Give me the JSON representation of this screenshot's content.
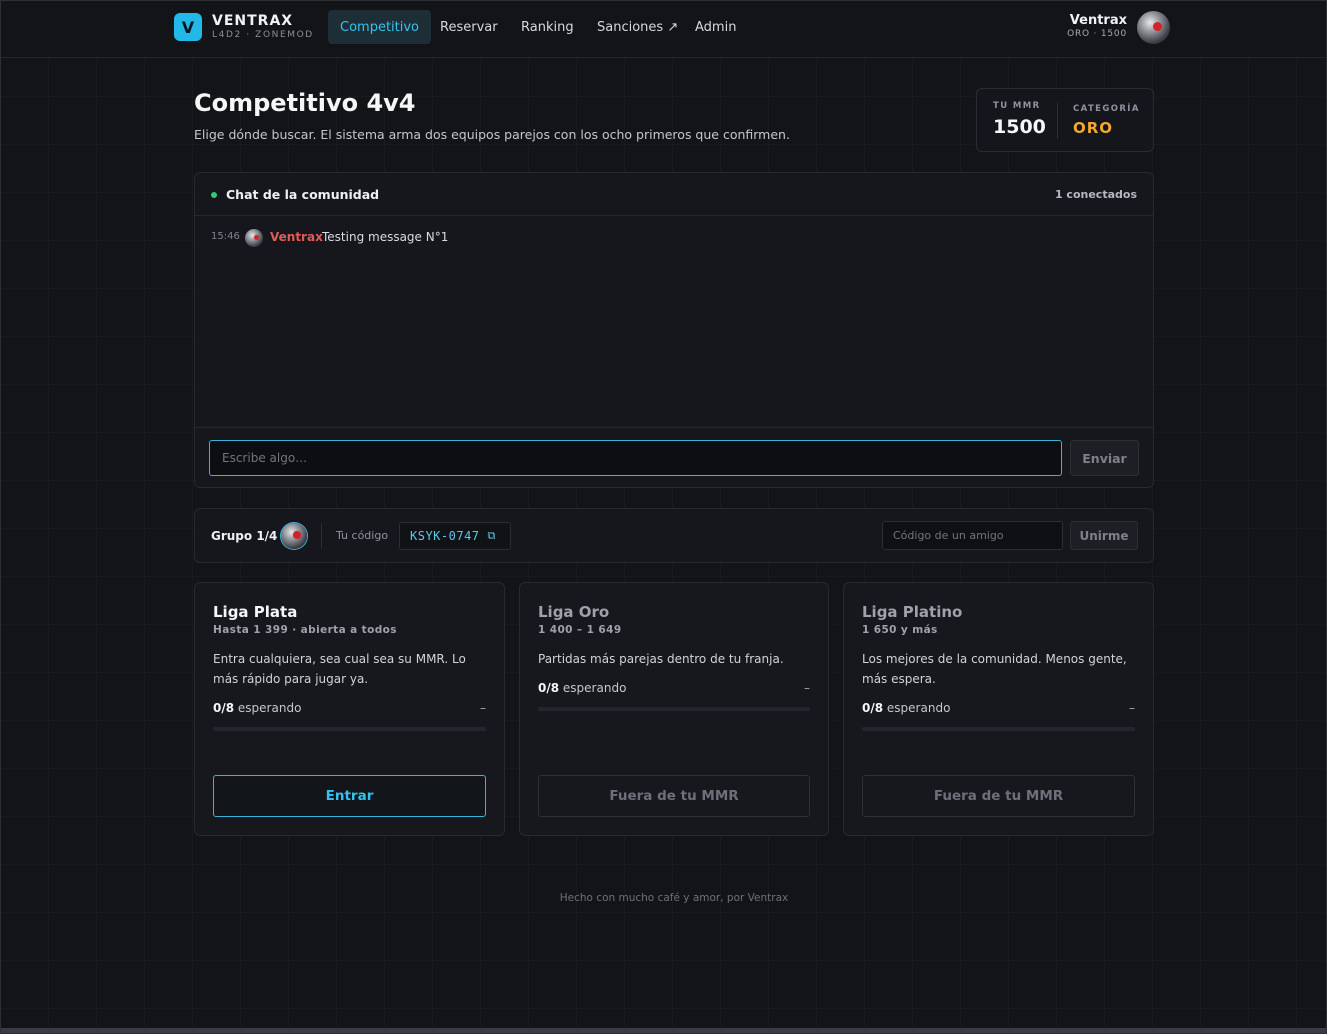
{
  "brand": {
    "logo_letter": "V",
    "name": "VENTRAX",
    "subtitle": "L4D2 · ZONEMOD"
  },
  "nav": {
    "items": [
      {
        "label": "Competitivo",
        "active": true
      },
      {
        "label": "Reservar",
        "active": false
      },
      {
        "label": "Ranking",
        "active": false
      },
      {
        "label": "Sanciones ↗",
        "active": false
      },
      {
        "label": "Admin",
        "active": false
      }
    ]
  },
  "user": {
    "name": "Ventrax",
    "sub": "ORO · 1500",
    "avatar_icon": "skull-avatar"
  },
  "header": {
    "title": "Competitivo 4v4",
    "subtitle": "Elige dónde buscar. El sistema arma dos equipos parejos con los ocho primeros que confirmen."
  },
  "stats": {
    "mmr_label": "TU MMR",
    "mmr_value": "1500",
    "category_label": "CATEGORÍA",
    "category_value": "ORO"
  },
  "chat": {
    "title": "Chat de la comunidad",
    "online": "1 conectados",
    "messages": [
      {
        "time": "15:46",
        "author": "Ventrax",
        "text": "Testing message N°1"
      }
    ],
    "input_placeholder": "Escribe algo…",
    "send_label": "Enviar"
  },
  "group": {
    "label": "Grupo 1/4",
    "code_label": "Tu código",
    "code": "KSYK-0747",
    "friend_placeholder": "Código de un amigo",
    "join_label": "Unirme"
  },
  "leagues": [
    {
      "title": "Liga Plata",
      "range": "Hasta 1 399 · abierta a todos",
      "description": "Entra cualquiera, sea cual sea su MMR. Lo más rápido para jugar ya.",
      "count": "0/8",
      "count_suffix": "esperando",
      "dash": "–",
      "fill": 0,
      "button": "Entrar",
      "enabled": true
    },
    {
      "title": "Liga Oro",
      "range": "1 400 – 1 649",
      "description": "Partidas más parejas dentro de tu franja.",
      "count": "0/8",
      "count_suffix": "esperando",
      "dash": "–",
      "fill": 0,
      "button": "Fuera de tu MMR",
      "enabled": false
    },
    {
      "title": "Liga Platino",
      "range": "1 650 y más",
      "description": "Los mejores de la comunidad. Menos gente, más espera.",
      "count": "0/8",
      "count_suffix": "esperando",
      "dash": "–",
      "fill": 0,
      "button": "Fuera de tu MMR",
      "enabled": false
    }
  ],
  "footer": {
    "text": "Hecho con mucho café y amor, por Ventrax"
  },
  "colors": {
    "accent": "#33c3f0",
    "gold": "#f0a830",
    "online": "#2ecc71",
    "author": "#e05a5a"
  }
}
